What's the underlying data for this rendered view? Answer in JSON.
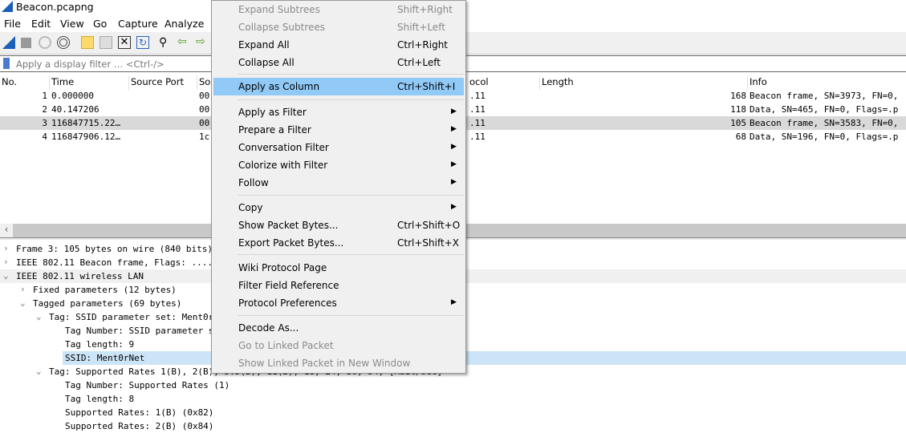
{
  "window": {
    "title": "Beacon.pcapng"
  },
  "menubar": [
    "File",
    "Edit",
    "View",
    "Go",
    "Capture",
    "Analyze"
  ],
  "filter": {
    "placeholder": "Apply a display filter … <Ctrl-/>"
  },
  "columns": [
    "No.",
    "Time",
    "Source Port",
    "So",
    "ocol",
    "Length",
    "Info"
  ],
  "packets": [
    {
      "no": "1",
      "time": "0.000000",
      "src": "00",
      "proto": ".11",
      "len": "168",
      "info": "Beacon frame, SN=3973, FN=0,"
    },
    {
      "no": "2",
      "time": "40.147206",
      "src": "00",
      "proto": ".11",
      "len": "118",
      "info": "Data, SN=465, FN=0, Flags=.p"
    },
    {
      "no": "3",
      "time": "116847715.22…",
      "src": "00",
      "proto": ".11",
      "len": "105",
      "info": "Beacon frame, SN=3583, FN=0,"
    },
    {
      "no": "4",
      "time": "116847906.12…",
      "src": "1c",
      "proto": ".11",
      "len": "68",
      "info": "Data, SN=196, FN=0, Flags=.p"
    }
  ],
  "details": [
    {
      "text": "Frame 3: 105 bytes on wire (840 bits), 105 bytes captured (840 bits) on interface 0",
      "exp": "›"
    },
    {
      "text": "IEEE 802.11 Beacon frame, Flags: ........",
      "exp": "›"
    },
    {
      "text": "IEEE 802.11 wireless LAN",
      "exp": "⌄"
    },
    {
      "text": "Fixed parameters (12 bytes)",
      "exp": "›"
    },
    {
      "text": "Tagged parameters (69 bytes)",
      "exp": "⌄"
    },
    {
      "text": "Tag: SSID parameter set: Ment0rNet",
      "exp": "⌄"
    },
    {
      "text": "Tag Number: SSID parameter set (0)",
      "exp": ""
    },
    {
      "text": "Tag length: 9",
      "exp": ""
    },
    {
      "text": "SSID: Ment0rNet",
      "exp": ""
    },
    {
      "text": "Tag: Supported Rates 1(B), 2(B), 5.5(B), 11(B), 18, 24, 36, 54, [Mbit/sec]",
      "exp": "⌄"
    },
    {
      "text": "Tag Number: Supported Rates (1)",
      "exp": ""
    },
    {
      "text": "Tag length: 8",
      "exp": ""
    },
    {
      "text": "Supported Rates: 1(B) (0x82)",
      "exp": ""
    },
    {
      "text": "Supported Rates: 2(B) (0x84)",
      "exp": ""
    }
  ],
  "context_menu": [
    {
      "label": "Expand Subtrees",
      "shortcut": "Shift+Right",
      "disabled": true
    },
    {
      "label": "Collapse Subtrees",
      "shortcut": "Shift+Left",
      "disabled": true
    },
    {
      "label": "Expand All",
      "shortcut": "Ctrl+Right"
    },
    {
      "label": "Collapse All",
      "shortcut": "Ctrl+Left"
    },
    {
      "label": "Apply as Column",
      "shortcut": "Ctrl+Shift+I",
      "active": true
    },
    {
      "label": "Apply as Filter",
      "submenu": "▶"
    },
    {
      "label": "Prepare a Filter",
      "submenu": "▶"
    },
    {
      "label": "Conversation Filter",
      "submenu": "▶"
    },
    {
      "label": "Colorize with Filter",
      "submenu": "▶"
    },
    {
      "label": "Follow",
      "submenu": "▶"
    },
    {
      "label": "Copy",
      "submenu": "▶"
    },
    {
      "label": "Show Packet Bytes...",
      "shortcut": "Ctrl+Shift+O"
    },
    {
      "label": "Export Packet Bytes...",
      "shortcut": "Ctrl+Shift+X"
    },
    {
      "label": "Wiki Protocol Page"
    },
    {
      "label": "Filter Field Reference"
    },
    {
      "label": "Protocol Preferences",
      "submenu": "▶"
    },
    {
      "label": "Decode As..."
    },
    {
      "label": "Go to Linked Packet",
      "disabled": true
    },
    {
      "label": "Show Linked Packet in New Window",
      "disabled": true
    }
  ],
  "colors": {
    "selection": "#91c9f7",
    "detail_highlight": "#cce4f7",
    "selected_row": "#d9d9d9"
  },
  "scrollbar": {
    "left_arrow": "‹"
  }
}
